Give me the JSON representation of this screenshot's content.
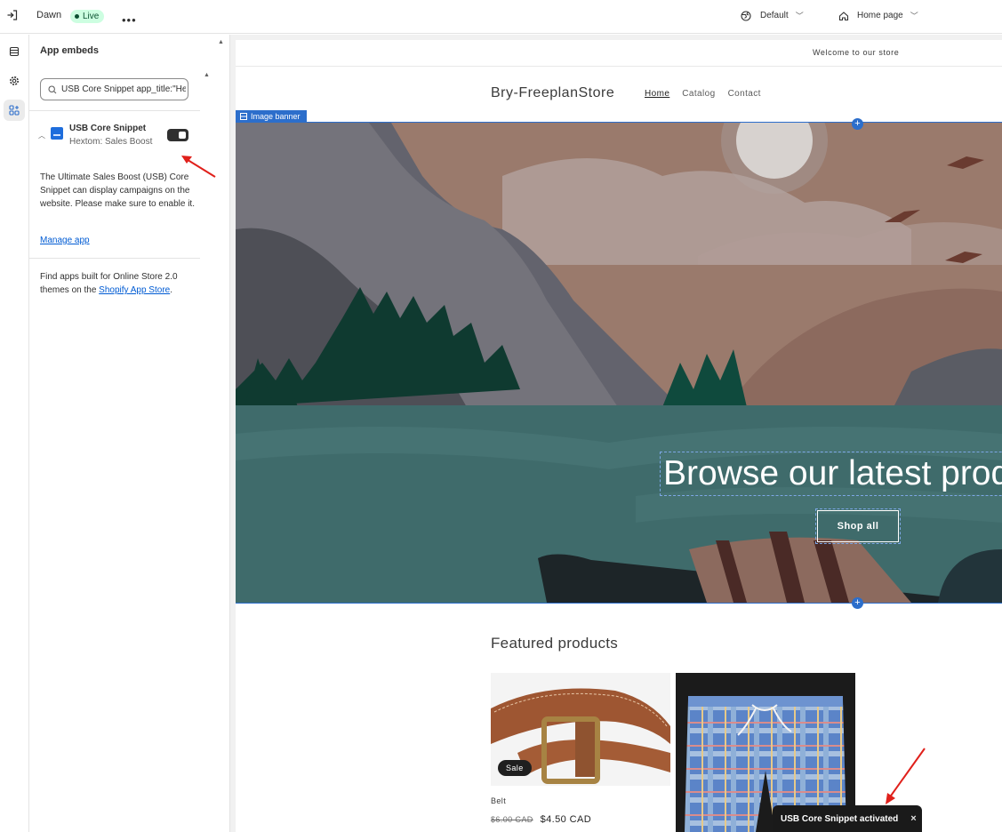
{
  "topbar": {
    "theme_name": "Dawn",
    "live_label": "Live",
    "more_label": "•••",
    "default_label": "Default",
    "page_label": "Home page"
  },
  "sidebar": {
    "title": "App embeds",
    "search_value": "USB Core Snippet app_title:\"Hextom: Sales Boost\"",
    "embed": {
      "name": "USB Core Snippet",
      "subtitle": "Hextom: Sales Boost",
      "enabled": true
    },
    "description": "The Ultimate Sales Boost (USB) Core Snippet can display campaigns on the website. Please make sure to enable it.",
    "manage_link": "Manage app",
    "find_apps_text": "Find apps built for Online Store 2.0 themes on the ",
    "find_apps_link": "Shopify App Store",
    "find_apps_end": "."
  },
  "preview": {
    "announcement": "Welcome to our store",
    "store_name": "Bry-FreeplanStore",
    "nav": [
      "Home",
      "Catalog",
      "Contact"
    ],
    "section_tag": "Image banner",
    "banner_heading": "Browse our latest products",
    "shop_button": "Shop all",
    "featured_title": "Featured products",
    "products": [
      {
        "name": "Belt",
        "old_price": "$6.00 CAD",
        "price": "$4.50 CAD",
        "badge": "Sale"
      },
      {
        "name": "",
        "old_price": "",
        "price": "",
        "badge": ""
      }
    ]
  },
  "toast": {
    "message": "USB Core Snippet activated",
    "close": "×"
  },
  "colors": {
    "accent": "#2c6ecb",
    "link": "#005bd3",
    "live_bg": "#cdfee1",
    "annotation": "#e0201b"
  }
}
